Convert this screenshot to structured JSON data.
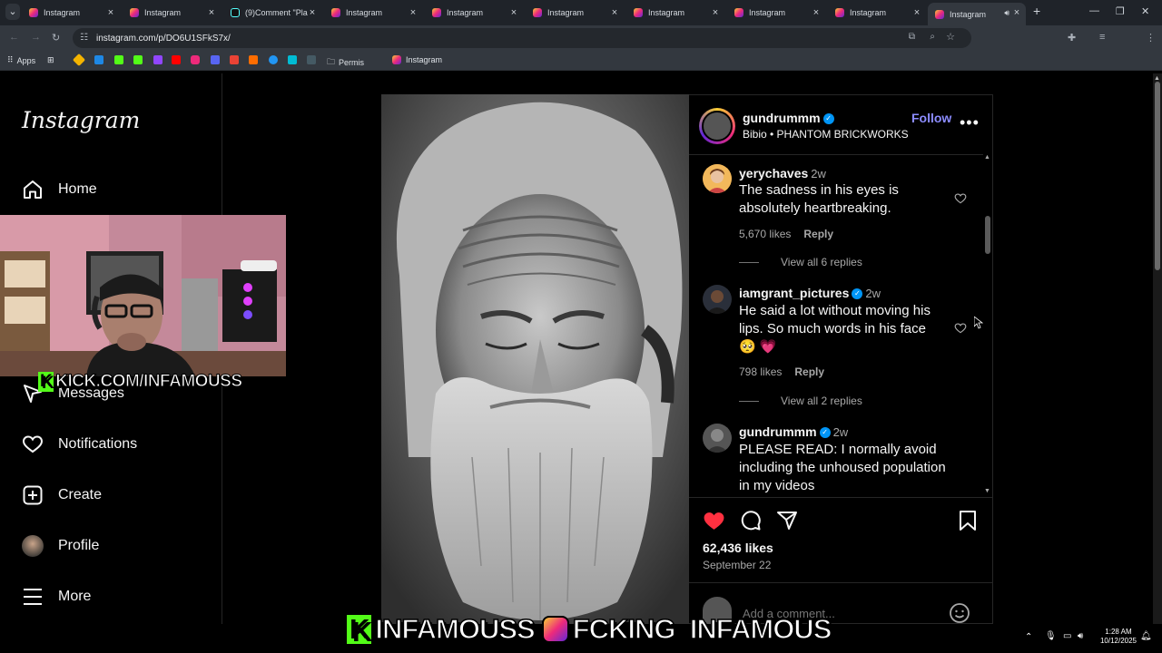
{
  "browser": {
    "tabs": [
      {
        "label": "Instagram",
        "kind": "instagram"
      },
      {
        "label": "Instagram",
        "kind": "instagram"
      },
      {
        "label": "(9)Comment \"Pla",
        "kind": "tiktok"
      },
      {
        "label": "Instagram",
        "kind": "instagram"
      },
      {
        "label": "Instagram",
        "kind": "instagram"
      },
      {
        "label": "Instagram",
        "kind": "instagram"
      },
      {
        "label": "Instagram",
        "kind": "instagram"
      },
      {
        "label": "Instagram",
        "kind": "instagram"
      },
      {
        "label": "Instagram",
        "kind": "instagram"
      },
      {
        "label": "Instagram",
        "kind": "instagram",
        "active": true
      }
    ],
    "url": "instagram.com/p/DO6U1SFkS7x/",
    "bookmarks": {
      "apps": "Apps",
      "permis": "Permis",
      "instagram": "Instagram"
    }
  },
  "sidebar": {
    "logo": "Instagram",
    "nav": {
      "home": "Home",
      "messages": "Messages",
      "notifications": "Notifications",
      "create": "Create",
      "profile": "Profile",
      "more": "More"
    }
  },
  "overlay": {
    "kick_url": "KICK.COM/INFAMOUSS",
    "banner_kick": "INFAMOUSS",
    "banner_ig": "FCKING_INFAMOUS"
  },
  "post": {
    "author": "gundrummm",
    "follow": "Follow",
    "subtitle": "Bibio • PHANTOM BRICKWORKS",
    "likes": "62,436 likes",
    "date": "September 22",
    "add_comment_placeholder": "Add a comment..."
  },
  "comments": [
    {
      "user": "yerychaves",
      "time": "2w",
      "text": "The sadness in his eyes is absolutely heartbreaking.",
      "likes": "5,670 likes",
      "reply": "Reply",
      "view_replies": "View all 6 replies"
    },
    {
      "user": "iamgrant_pictures",
      "time": "2w",
      "verified": true,
      "text": "He said a lot without moving his lips. So much words in his face",
      "emoji": "🥺 💗",
      "likes": "798 likes",
      "reply": "Reply",
      "view_replies": "View all 2 replies"
    },
    {
      "user": "gundrummm",
      "time": "2w",
      "verified": true,
      "text": "PLEASE READ: I normally avoid including the unhoused population in my videos"
    }
  ],
  "taskbar": {
    "time": "1:28 AM",
    "date": "10/12/2025"
  },
  "colors": {
    "accent": "#0095f6",
    "follow": "#8c8cff",
    "like": "#ff3040",
    "secondary_text": "#a8a8a8"
  }
}
